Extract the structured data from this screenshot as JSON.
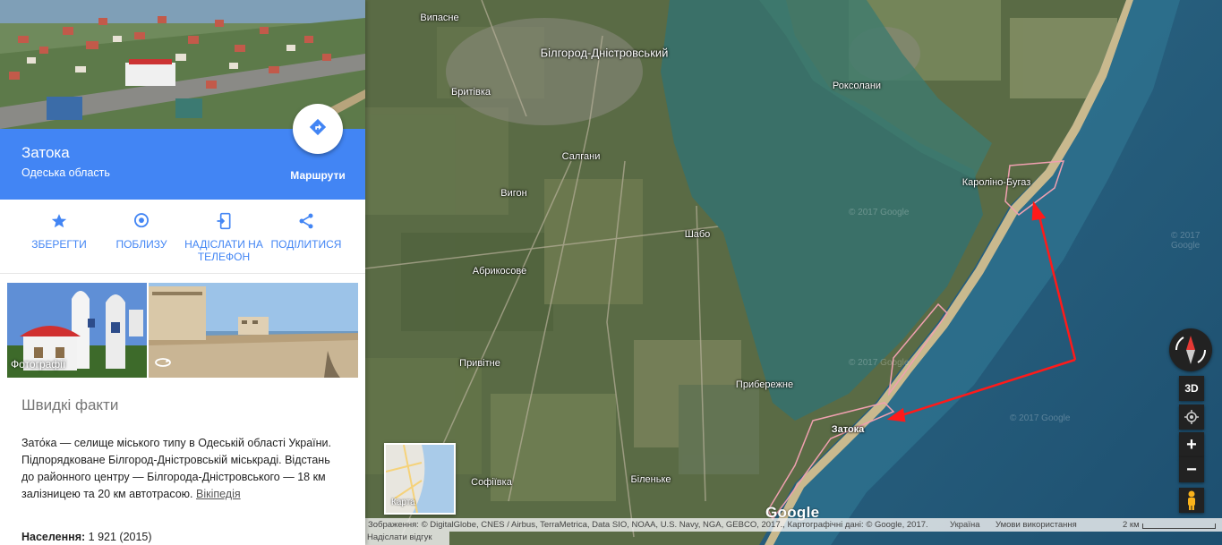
{
  "place": {
    "name": "Затока",
    "region": "Одеська область",
    "routes_label": "Маршрути"
  },
  "actions": [
    {
      "label": "ЗБЕРЕГТИ",
      "icon": "star-icon"
    },
    {
      "label": "ПОБЛИЗУ",
      "icon": "nearby-pin-icon"
    },
    {
      "label": "НАДІСЛАТИ НА ТЕЛЕФОН",
      "icon": "send-to-phone-icon"
    },
    {
      "label": "ПОДІЛИТИСЯ",
      "icon": "share-icon"
    }
  ],
  "photos": {
    "label": "Фотографії"
  },
  "facts": {
    "title": "Швидкі факти",
    "text": "Зато́ка — селище міського типу в Одеській області України. Підпорядковане Білгород-Дністровській міськраді. Відстань до районного центру — Білгорода-Дністровського — 18 км залізницею та 20 км автотрасою.",
    "link": "Вікіпедія",
    "population_label": "Населення:",
    "population_value": "1 921 (2015)"
  },
  "map": {
    "labels": [
      {
        "text": "Випасне"
      },
      {
        "text": "Білгород-Дністровський"
      },
      {
        "text": "Роксолани"
      },
      {
        "text": "Бритівка"
      },
      {
        "text": "Салгани"
      },
      {
        "text": "Вигон"
      },
      {
        "text": "Кароліно-Бугаз"
      },
      {
        "text": "Шабо"
      },
      {
        "text": "Абрикосове"
      },
      {
        "text": "Привітне"
      },
      {
        "text": "Прибережне"
      },
      {
        "text": "Затока"
      },
      {
        "text": "Софіївка"
      },
      {
        "text": "Біленьке"
      }
    ],
    "minimap_label": "Карта",
    "logo": "Google",
    "attribution": "Зображення: © DigitalGlobe, CNES / Airbus, TerraMetrica, Data SIO, NOAA, U.S. Navy, NGA, GEBCO, 2017., Картографічні дані: © Google, 2017.",
    "country": "Україна",
    "terms": "Умови використання",
    "scale": "2 км",
    "feedback": "Надіслати відгук",
    "watermark": "© 2017 Google",
    "controls": {
      "three_d": "3D",
      "zoom_in": "+",
      "zoom_out": "−"
    }
  }
}
